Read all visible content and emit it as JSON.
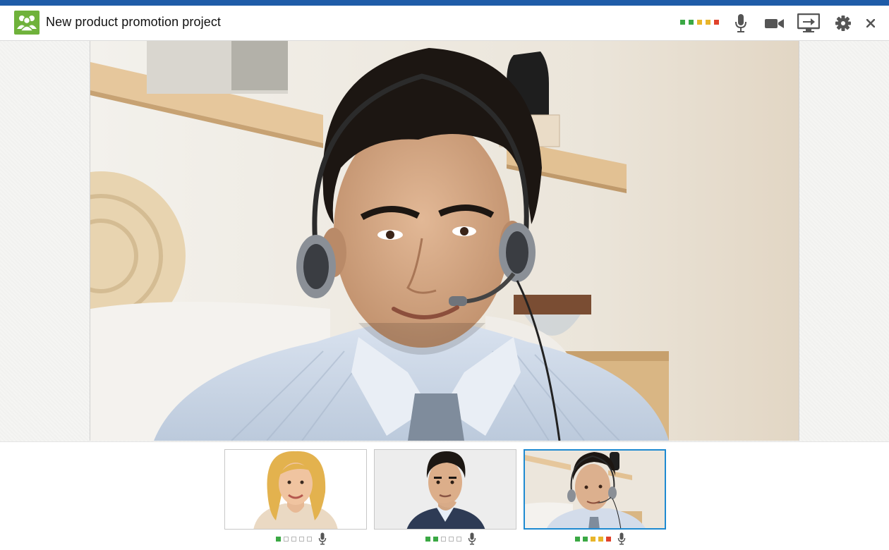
{
  "window": {
    "title": "New product promotion project",
    "accent_color": "#1f5ca8",
    "app_icon": "group-people-icon"
  },
  "toolbar": {
    "signal_levels": [
      "green",
      "green",
      "yellow",
      "yellow",
      "red"
    ],
    "buttons": [
      "microphone-icon",
      "video-camera-icon",
      "screen-share-icon",
      "settings-gear-icon",
      "close-icon"
    ]
  },
  "main_video": {
    "participant_icon": "active-speaker-video"
  },
  "participants": [
    {
      "signal_levels": [
        "green",
        "empty",
        "empty",
        "empty",
        "empty"
      ],
      "mic": "microphone-icon",
      "active": false
    },
    {
      "signal_levels": [
        "green",
        "green",
        "empty",
        "empty",
        "empty"
      ],
      "mic": "microphone-icon",
      "active": false
    },
    {
      "signal_levels": [
        "green",
        "green",
        "yellow",
        "yellow",
        "red"
      ],
      "mic": "microphone-icon",
      "active": true,
      "highlight_color": "#1e8ad1"
    }
  ]
}
